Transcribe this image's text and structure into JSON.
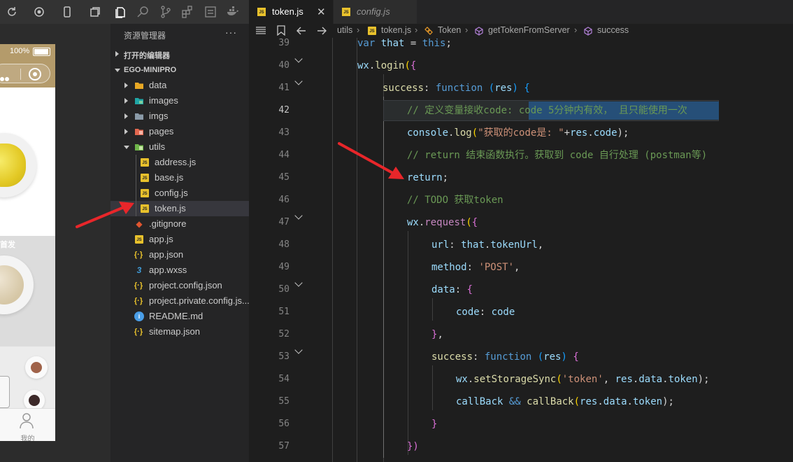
{
  "simulator": {
    "battery_pct": "100%",
    "section2_label": "首发",
    "tab_label": "我的"
  },
  "explorer": {
    "title": "资源管理器",
    "more": "···",
    "open_editors": "打开的编辑器",
    "project": "EGO-MINIPRO",
    "items": [
      {
        "name": "data"
      },
      {
        "name": "images"
      },
      {
        "name": "imgs"
      },
      {
        "name": "pages"
      },
      {
        "name": "utils"
      },
      {
        "name": "address.js"
      },
      {
        "name": "base.js"
      },
      {
        "name": "config.js"
      },
      {
        "name": "token.js"
      },
      {
        "name": ".gitignore"
      },
      {
        "name": "app.js"
      },
      {
        "name": "app.json"
      },
      {
        "name": "app.wxss"
      },
      {
        "name": "project.config.json"
      },
      {
        "name": "project.private.config.js..."
      },
      {
        "name": "README.md"
      },
      {
        "name": "sitemap.json"
      }
    ]
  },
  "tabs": [
    {
      "label": "token.js"
    },
    {
      "label": "config.js"
    }
  ],
  "breadcrumb": {
    "utils": "utils",
    "file": "token.js",
    "class": "Token",
    "method": "getTokenFromServer",
    "prop": "success"
  },
  "line_numbers": [
    "39",
    "40",
    "41",
    "42",
    "43",
    "44",
    "45",
    "46",
    "47",
    "48",
    "49",
    "50",
    "51",
    "52",
    "53",
    "54",
    "55",
    "56",
    "57"
  ],
  "code": {
    "l39": [
      "var",
      " ",
      "that",
      " = ",
      "this",
      ";"
    ],
    "l40": [
      "wx",
      ".",
      "login",
      "(",
      "{"
    ],
    "l41": [
      "success",
      ": ",
      "function",
      " ",
      "(",
      "res",
      ")",
      " ",
      "{"
    ],
    "l42": "// 定义变量接收code: code 5分钟内有效， 且只能使用一次",
    "l43": [
      "console",
      ".",
      "log",
      "(",
      "\"获取的code是: \"",
      "+",
      "res",
      ".",
      "code",
      ");"
    ],
    "l44": "// return 结束函数执行。获取到 code 自行处理 (postman等)",
    "l45": [
      "return",
      ";"
    ],
    "l46": "// TODO 获取token",
    "l47": [
      "wx",
      ".",
      "request",
      "(",
      "{"
    ],
    "l48": [
      "url",
      ": ",
      "that",
      ".",
      "tokenUrl",
      ","
    ],
    "l49": [
      "method",
      ": ",
      "'POST'",
      ","
    ],
    "l50": [
      "data",
      ": ",
      "{"
    ],
    "l51": [
      "code",
      ": ",
      "code"
    ],
    "l52": [
      "}",
      ","
    ],
    "l53": [
      "success",
      ": ",
      "function",
      " ",
      "(",
      "res",
      ")",
      " ",
      "{"
    ],
    "l54": [
      "wx",
      ".",
      "setStorageSync",
      "(",
      "'token'",
      ", ",
      "res",
      ".",
      "data",
      ".",
      "token",
      ");"
    ],
    "l55": [
      "callBack",
      " ",
      "&&",
      " ",
      "callBack",
      "(",
      "res",
      ".",
      "data",
      ".",
      "token",
      ");"
    ],
    "l56": [
      "}"
    ],
    "l57": [
      "})"
    ]
  },
  "colors": {
    "arrow": "#e8262a",
    "accent_js": "#e8c12c"
  }
}
